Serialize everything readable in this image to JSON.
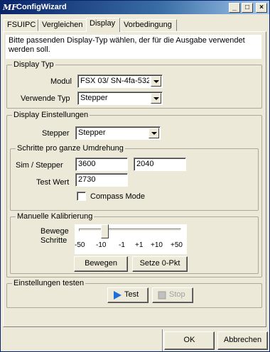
{
  "window": {
    "title": "ConfigWizard",
    "logo_text": "MF"
  },
  "title_buttons": {
    "minimize": "_",
    "maximize": "□",
    "close": "×"
  },
  "tabs": [
    {
      "label": "FSUIPC"
    },
    {
      "label": "Vergleichen"
    },
    {
      "label": "Display",
      "active": true
    },
    {
      "label": "Vorbedingung"
    }
  ],
  "description": "Bitte passenden Display-Typ wählen, der für die Ausgabe verwendet werden soll.",
  "display_typ": {
    "legend": "Display Typ",
    "modul_label": "Modul",
    "modul_value": "FSX 03/ SN-4fa-532",
    "typ_label": "Verwende Typ",
    "typ_value": "Stepper"
  },
  "display_einstellungen": {
    "legend": "Display Einstellungen",
    "stepper_label": "Stepper",
    "stepper_value": "Stepper"
  },
  "schritte": {
    "legend": "Schritte pro ganze Umdrehung",
    "sim_label": "Sim / Stepper",
    "sim_value": "3600",
    "stepper_value": "2040",
    "test_label": "Test Wert",
    "test_value": "2730",
    "compass_label": "Compass Mode",
    "compass_checked": false
  },
  "kalibrierung": {
    "legend": "Manuelle Kalibrierung",
    "bewege_label": "Bewege",
    "schritte_label": "Schritte",
    "ticks": [
      "-50",
      "-10",
      "-1",
      "+1",
      "+10",
      "+50"
    ],
    "slider_position": 0.25,
    "bewegen_button": "Bewegen",
    "setze_button": "Setze 0-Pkt"
  },
  "testen": {
    "legend": "Einstellungen testen",
    "test_button": "Test",
    "stop_button": "Stop"
  },
  "footer": {
    "ok_button": "OK",
    "cancel_button": "Abbrechen"
  }
}
